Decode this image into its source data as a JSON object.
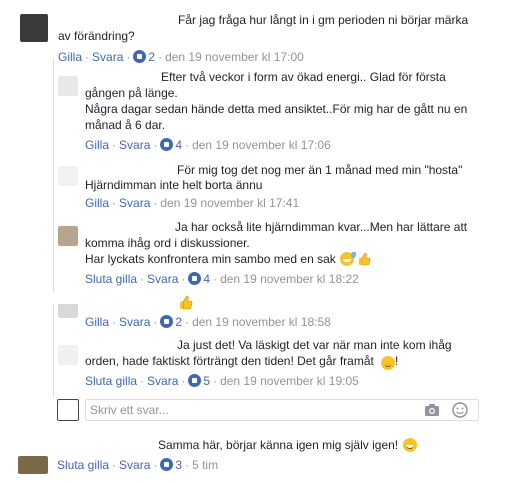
{
  "comments": [
    {
      "text_lines": [
        "Får jag fråga hur långt in i gm perioden ni börjar märka",
        "av förändring?"
      ],
      "actions": {
        "like": "Gilla",
        "reply": "Svara",
        "likes": "2",
        "time": "den 19 november kl 17:00"
      }
    },
    {
      "text_lines": [
        "Efter två veckor i form av ökad energi.. Glad för första",
        "gången på länge.",
        "Några dagar sedan hände detta med ansiktet..För mig har de gått nu en",
        "månad å 6 dar."
      ],
      "actions": {
        "like": "Gilla",
        "reply": "Svara",
        "likes": "4",
        "time": "den 19 november kl 17:06"
      }
    },
    {
      "text_lines": [
        "För mig tog det nog mer än 1 månad med min \"hosta\"",
        "Hjärndimman inte helt borta ännu"
      ],
      "actions": {
        "like": "Gilla",
        "reply": "Svara",
        "likes": "",
        "time": "den 19 november kl 17:41"
      }
    },
    {
      "text_lines": [
        "Ja har också lite hjärndimman kvar...Men har lättare att",
        "komma ihåg ord i diskussioner.",
        "Har lyckats konfrontera min sambo med en sak"
      ],
      "actions": {
        "like": "Sluta gilla",
        "reply": "Svara",
        "likes": "4",
        "time": "den 19 november kl 18:22"
      }
    },
    {
      "text_lines": [],
      "actions": {
        "like": "Gilla",
        "reply": "Svara",
        "likes": "2",
        "time": "den 19 november kl 18:58"
      }
    },
    {
      "text_lines": [
        "Ja just det! Va läskigt det var när man inte kom ihåg",
        "orden, hade faktiskt förträngt den tiden! Det går framåt",
        "!"
      ],
      "actions": {
        "like": "Sluta gilla",
        "reply": "Svara",
        "likes": "5",
        "time": "den 19 november kl 19:05"
      }
    },
    {
      "text_lines": [
        "Samma här, börjar känna igen mig själv igen!"
      ],
      "actions": {
        "like": "Sluta gilla",
        "reply": "Svara",
        "likes": "3",
        "time": "5 tim"
      }
    }
  ],
  "reply_box": {
    "placeholder": "Skriv ett svar..."
  },
  "colors": {
    "link": "#4267b2",
    "meta": "#90949c",
    "text": "#1d2129",
    "divider": "#dddfe2"
  },
  "icons": [
    "like-badge-icon",
    "grinning-sweat-emoji-icon",
    "thumbs-up-emoji-icon",
    "slight-smile-emoji-icon",
    "grinning-emoji-icon",
    "camera-icon",
    "sticker-icon"
  ]
}
